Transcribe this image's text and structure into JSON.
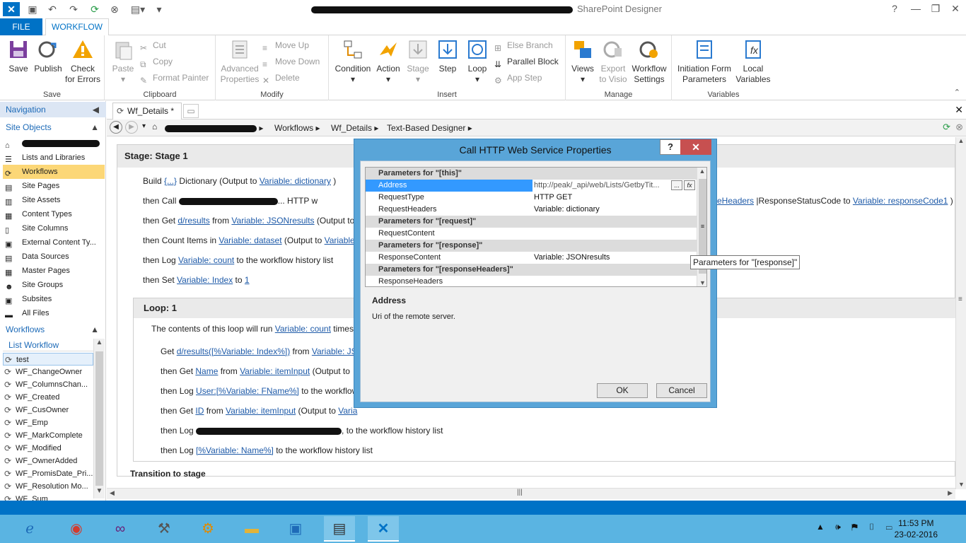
{
  "app": {
    "title_suffix": "SharePoint Designer"
  },
  "ribbon_tabs": {
    "file": "FILE",
    "workflow": "WORKFLOW"
  },
  "ribbon": {
    "save_group": {
      "label": "Save",
      "save": "Save",
      "publish": "Publish",
      "check": "Check\nfor Errors"
    },
    "clipboard_group": {
      "label": "Clipboard",
      "paste": "Paste",
      "cut": "Cut",
      "copy": "Copy",
      "format_painter": "Format Painter"
    },
    "modify_group": {
      "label": "Modify",
      "advanced": "Advanced\nProperties",
      "move_up": "Move Up",
      "move_down": "Move Down",
      "delete": "Delete"
    },
    "insert_group": {
      "label": "Insert",
      "condition": "Condition",
      "action": "Action",
      "stage": "Stage",
      "step": "Step",
      "loop": "Loop",
      "else_branch": "Else Branch",
      "parallel_block": "Parallel Block",
      "app_step": "App Step"
    },
    "manage_group": {
      "label": "Manage",
      "views": "Views",
      "export": "Export\nto Visio",
      "wf_settings": "Workflow\nSettings"
    },
    "variables_group": {
      "label": "Variables",
      "init_form": "Initiation Form\nParameters",
      "local_vars": "Local\nVariables"
    }
  },
  "nav": {
    "title": "Navigation",
    "site_objects": "Site Objects",
    "items": [
      {
        "label": "Lists and Libraries"
      },
      {
        "label": "Workflows"
      },
      {
        "label": "Site Pages"
      },
      {
        "label": "Site Assets"
      },
      {
        "label": "Content Types"
      },
      {
        "label": "Site Columns"
      },
      {
        "label": "External Content Ty..."
      },
      {
        "label": "Data Sources"
      },
      {
        "label": "Master Pages"
      },
      {
        "label": "Site Groups"
      },
      {
        "label": "Subsites"
      },
      {
        "label": "All Files"
      }
    ],
    "workflows_title": "Workflows",
    "list_workflow": "List Workflow",
    "workflows": [
      "test",
      "WF_ChangeOwner",
      "WF_ColumnsChan...",
      "WF_Created",
      "WF_CusOwner",
      "WF_Emp",
      "WF_MarkComplete",
      "WF_Modified",
      "WF_OwnerAdded",
      "WF_PromisDate_Pri...",
      "WF_Resolution Mo...",
      "WF_Sum"
    ]
  },
  "doc_tab": "Wf_Details *",
  "breadcrumb": [
    "Workflows",
    "Wf_Details",
    "Text-Based Designer"
  ],
  "designer": {
    "stage_title": "Stage: Stage 1",
    "lines": {
      "l1a": "Build ",
      "l1b": "{...}",
      "l1c": " Dictionary (Output to ",
      "l1d": "Variable: dictionary",
      "l1e": " )",
      "l2a": "then Call ",
      "l2b": "... HTTP w",
      "l2c": "eHeaders",
      "l2d": " |ResponseStatusCode to ",
      "l2e": "Variable: responseCode1",
      "l2f": " )",
      "l3a": "then Get ",
      "l3b": "d/results",
      "l3c": " from ",
      "l3d": "Variable: JSONresults",
      "l3e": " (Output to",
      "l4a": "then Count Items in ",
      "l4b": "Variable: dataset",
      "l4c": " (Output to ",
      "l4d": "Variable",
      "l5a": "then Log ",
      "l5b": "Variable: count",
      "l5c": " to the workflow history list",
      "l6a": "then Set ",
      "l6b": "Variable: Index",
      "l6c": " to ",
      "l6d": "1"
    },
    "loop_title": "Loop: 1",
    "loop_lines": {
      "a1": "The contents of this loop will run ",
      "a2": "Variable: count",
      "a3": " times",
      "b1": "Get ",
      "b2": "d/results([%Variable: Index%])",
      "b3": " from ",
      "b4": "Variable: JSO",
      "c1": "then Get ",
      "c2": "Name",
      "c3": " from ",
      "c4": "Variable: itemInput",
      "c5": " (Output to",
      "d1": "then Log ",
      "d2": "User:[%Variable: FName%]",
      "d3": " to the workflow",
      "e1": "then Get ",
      "e2": "ID",
      "e3": " from ",
      "e4": "Variable: itemInput",
      "e5": " (Output to ",
      "e6": "Varia",
      "f1": "then Log ",
      "f2": ", to the workflow history list",
      "g1": "then Log ",
      "g2": "[%Variable: Name%]",
      "g3": " to the workflow history list"
    },
    "transition": "Transition to stage"
  },
  "dialog": {
    "title": "Call HTTP Web Service Properties",
    "help": "?",
    "close": "✕",
    "rows": [
      {
        "group": "Parameters for \"[this]\""
      },
      {
        "name": "Address",
        "value": "http://peak/_api/web/Lists/GetbyTit..."
      },
      {
        "name": "RequestType",
        "value": "HTTP GET"
      },
      {
        "name": "RequestHeaders",
        "value": "Variable: dictionary"
      },
      {
        "group": "Parameters for \"[request]\""
      },
      {
        "name": "RequestContent",
        "value": ""
      },
      {
        "group": "Parameters for \"[response]\""
      },
      {
        "name": "ResponseContent",
        "value": "Variable: JSONresults"
      },
      {
        "group": "Parameters for \"[responseHeaders]\""
      },
      {
        "name": "ResponseHeaders",
        "value": ""
      }
    ],
    "desc_title": "Address",
    "desc_text": "Uri of the remote server.",
    "ok": "OK",
    "cancel": "Cancel"
  },
  "tooltip": "Parameters for \"[response]\"",
  "clock": {
    "time": "11:53 PM",
    "date": "23-02-2016"
  }
}
